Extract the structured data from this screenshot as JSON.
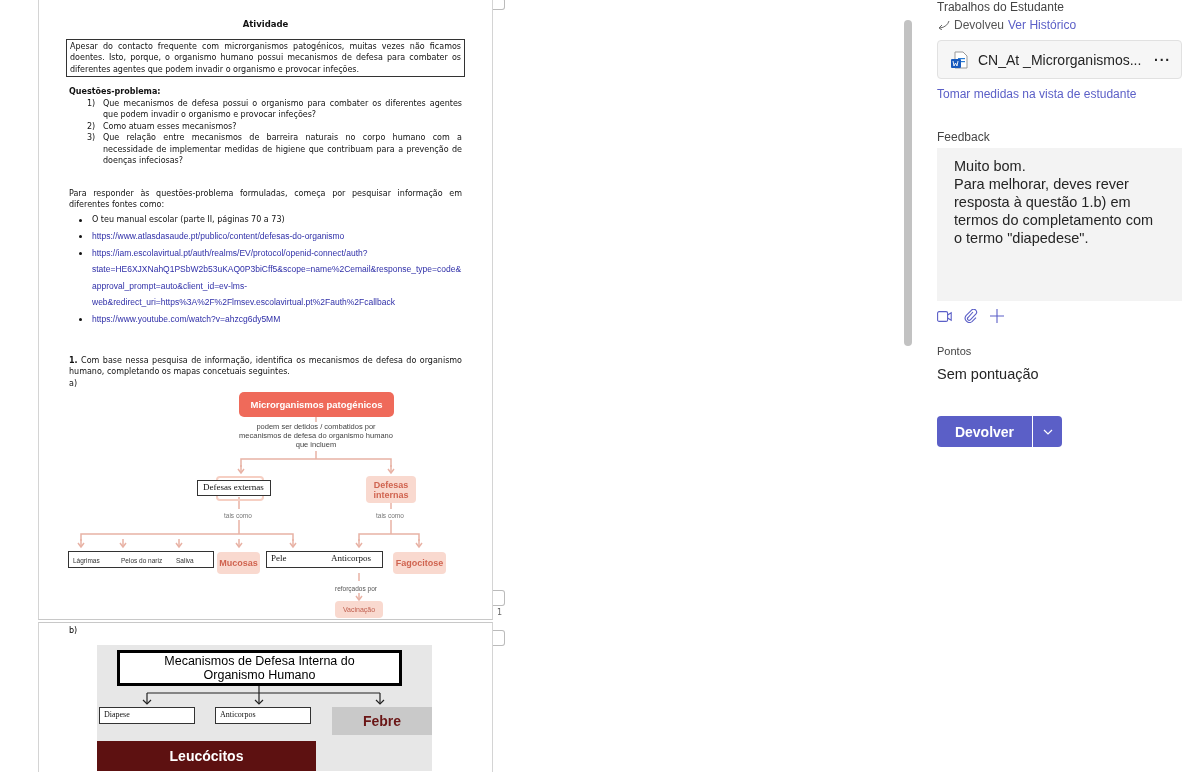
{
  "document": {
    "title": "Atividade",
    "intro": "Apesar do contacto frequente com microrganismos patogénicos, muitas vezes não ficamos doentes. Isto, porque, o organismo humano possui mecanismos de defesa para combater os diferentes agentes que podem invadir o organismo e provocar infeções.",
    "questions_heading": "Questões-problema:",
    "questions": [
      {
        "number": "1)",
        "text": "Que mecanismos de defesa possui o organismo para combater os diferentes agentes que podem invadir o organismo e provocar infeções?"
      },
      {
        "number": "2)",
        "text": "Como atuam esses mecanismos?"
      },
      {
        "number": "3)",
        "text": "Que relação entre mecanismos de barreira naturais no corpo humano com a necessidade de implementar medidas de higiene que contribuam para a prevenção de doenças infeciosas?"
      }
    ],
    "sources_intro": "Para responder às questões-problema formuladas, começa por pesquisar informação em diferentes fontes como:",
    "sources": [
      {
        "kind": "text",
        "text": "O teu manual escolar (parte II, páginas 70 a 73)"
      },
      {
        "kind": "link",
        "text": "https://www.atlasdasaude.pt/publico/content/defesas-do-organismo"
      },
      {
        "kind": "link",
        "text": "https://iam.escolavirtual.pt/auth/realms/EV/protocol/openid-connect/auth?state=HE6XJXNahQ1PSbW2b53uKAQ0P3biCff5&scope=name%2Cemail&response_type=code&approval_prompt=auto&client_id=ev-lms-web&redirect_uri=https%3A%2F%2Flmsev.escolavirtual.pt%2Fauth%2Fcallback"
      },
      {
        "kind": "link",
        "text": "https://www.youtube.com/watch?v=ahzcg6dy5MM"
      }
    ],
    "task": "**1.** Com base nessa pesquisa de informação, identifica os mecanismos de defesa do organismo humano, completando os mapas concetuais seguintes.",
    "part_a_label": "a)",
    "map_a": {
      "root": "Microrganismos patogénicos",
      "caption": "podem ser detidos / combatidos por mecanismos de defesa do organismo humano que incluem",
      "external_answer": "Defesas externas",
      "internal_label": "Defesas internas",
      "external_connector": "tais como",
      "internal_connector": "tais como",
      "external_answers": [
        "Lágrimas",
        "Pelos do nariz",
        "Saliva"
      ],
      "mucosas": "Mucosas",
      "row_answers": [
        "Pele",
        "Anticorpos"
      ],
      "fagocitose": "Fagocitose",
      "reinforced_connector": "reforçados por",
      "vaccination": "Vacinação"
    },
    "page_number": "1",
    "part_b_label": "b)",
    "map_b": {
      "header": "Mecanismos de Defesa Interna do Organismo Humano",
      "answers": [
        "Diapese",
        "Anticorpos"
      ],
      "fever": "Febre",
      "leukocytes": "Leucócitos"
    }
  },
  "panel": {
    "section_title": "Trabalhos do Estudante",
    "status": "Devolveu",
    "history_link": "Ver Histórico",
    "file": {
      "name": "CN_At _Microrganismos...",
      "more": "···"
    },
    "student_view_link": "Tomar medidas na vista de estudante",
    "feedback_label": "Feedback",
    "feedback": "Muito bom.\nPara melhorar, deves rever resposta à questão 1.b) em termos do completamento com o termo \"diapedese\".",
    "points_label": "Pontos",
    "points": "Sem pontuação",
    "return_button": "Devolver"
  }
}
